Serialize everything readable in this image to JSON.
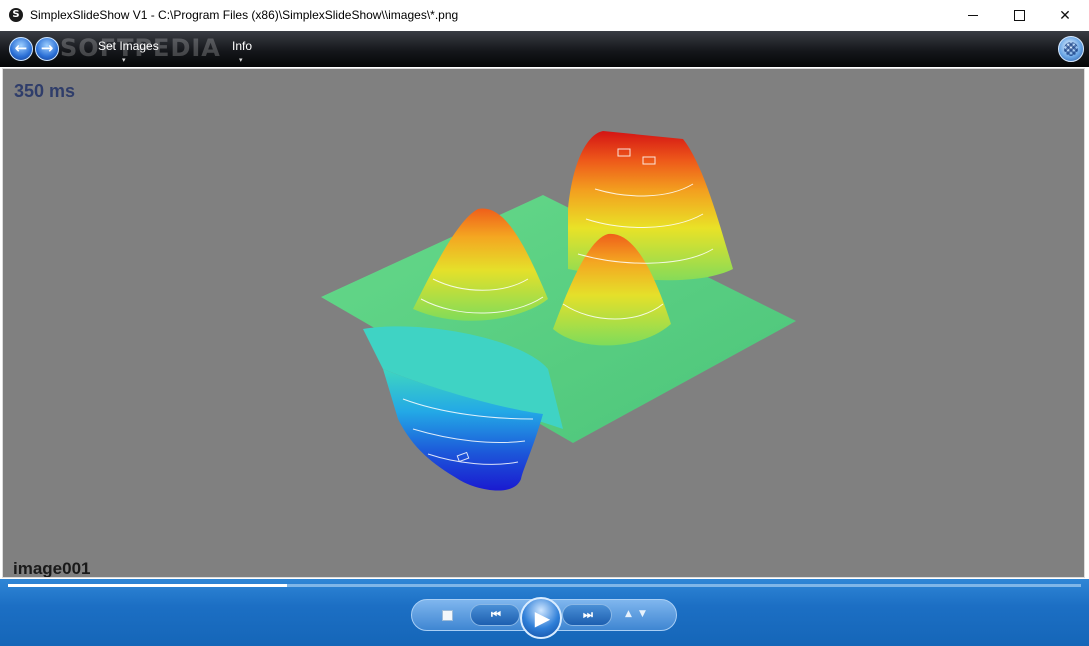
{
  "window": {
    "app_icon": "S",
    "title": "SimplexSlideShow V1 - C:\\Program Files (x86)\\SimplexSlideShow\\\\images\\*.png",
    "min_icon": "minimize-icon",
    "max_icon": "maximize-icon",
    "close_glyph": "✕"
  },
  "toolbar": {
    "back_glyph": "←",
    "forward_glyph": "→",
    "watermark": "SOFTPEDIA",
    "menu": [
      {
        "label": "Set Images"
      },
      {
        "label": "Info"
      }
    ],
    "caret": "▾"
  },
  "viewer": {
    "delay_label": "350 ms",
    "image_name": "image001",
    "background": "#808080"
  },
  "playback": {
    "progress_fraction": 0.26,
    "prev_glyph": "⏮",
    "play_glyph": "▶",
    "next_glyph": "⏭",
    "speed_up_glyph": "▲",
    "speed_down_glyph": "▼",
    "accent": "#1c6fc4"
  }
}
